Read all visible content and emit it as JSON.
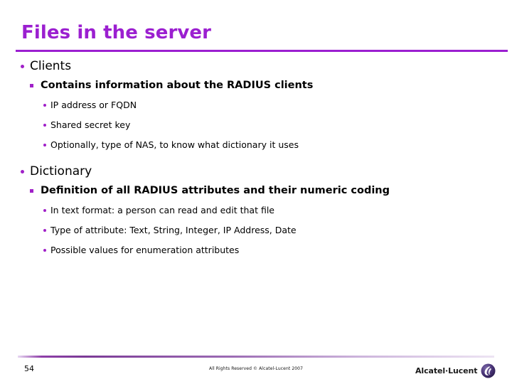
{
  "slide": {
    "title": "Files in the server",
    "outline": [
      {
        "level": 1,
        "bullet": "disc",
        "text": "Clients"
      },
      {
        "level": 2,
        "bullet": "square",
        "text": "Contains information about the RADIUS clients"
      },
      {
        "level": 3,
        "bullet": "dot",
        "text": "IP address or FQDN"
      },
      {
        "level": 3,
        "bullet": "dot",
        "text": "Shared secret key"
      },
      {
        "level": 3,
        "bullet": "dot",
        "text": "Optionally, type of NAS, to know what dictionary it uses"
      },
      {
        "level": 1,
        "bullet": "disc",
        "text": "Dictionary"
      },
      {
        "level": 2,
        "bullet": "square",
        "text": "Definition of all RADIUS attributes and their numeric coding"
      },
      {
        "level": 3,
        "bullet": "dot",
        "text": "In text format: a person can read and edit that file"
      },
      {
        "level": 3,
        "bullet": "dot",
        "text": "Type of attribute: Text, String, Integer, IP Address, Date"
      },
      {
        "level": 3,
        "bullet": "dot",
        "text": "Possible values for enumeration attributes"
      }
    ]
  },
  "footer": {
    "page_number": "54",
    "copyright": "All Rights Reserved © Alcatel-Lucent 2007",
    "logo_wordmark": "Alcatel·Lucent",
    "logo_mark_name": "alcatel-lucent-swirl-icon"
  },
  "colors": {
    "title": "#9B1FD0",
    "rule": "#9B1FD0",
    "bullet": "#A020C8",
    "logo_circle_dark": "#3D2A63",
    "logo_circle_light": "#6E5A9B",
    "body_text": "#000000"
  }
}
